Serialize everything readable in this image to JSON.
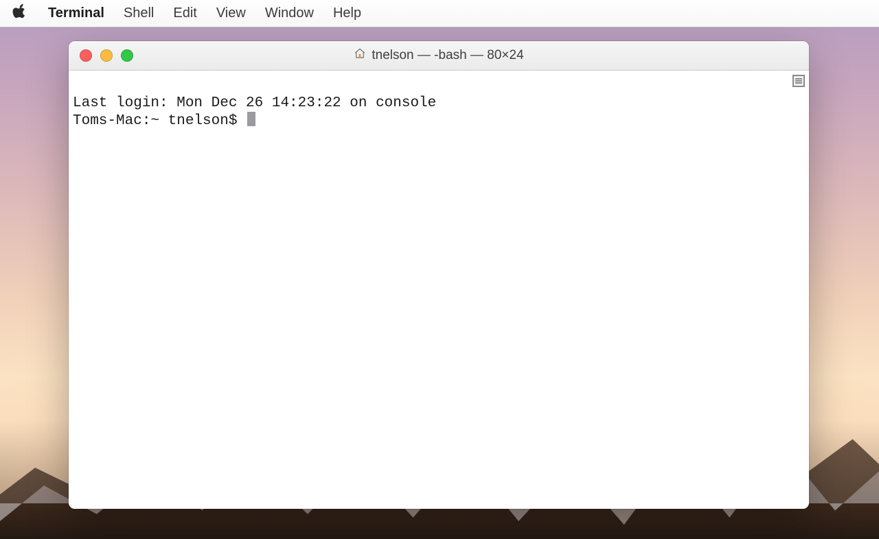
{
  "menubar": {
    "app_name": "Terminal",
    "menus": [
      "Shell",
      "Edit",
      "View",
      "Window",
      "Help"
    ]
  },
  "window": {
    "title": "tnelson — -bash — 80×24",
    "home_icon": "home-icon"
  },
  "terminal": {
    "last_login_line": "Last login: Mon Dec 26 14:23:22 on console",
    "prompt": "Toms-Mac:~ tnelson$ "
  },
  "traffic_lights": {
    "close": "close-button",
    "minimize": "minimize-button",
    "zoom": "zoom-button"
  }
}
